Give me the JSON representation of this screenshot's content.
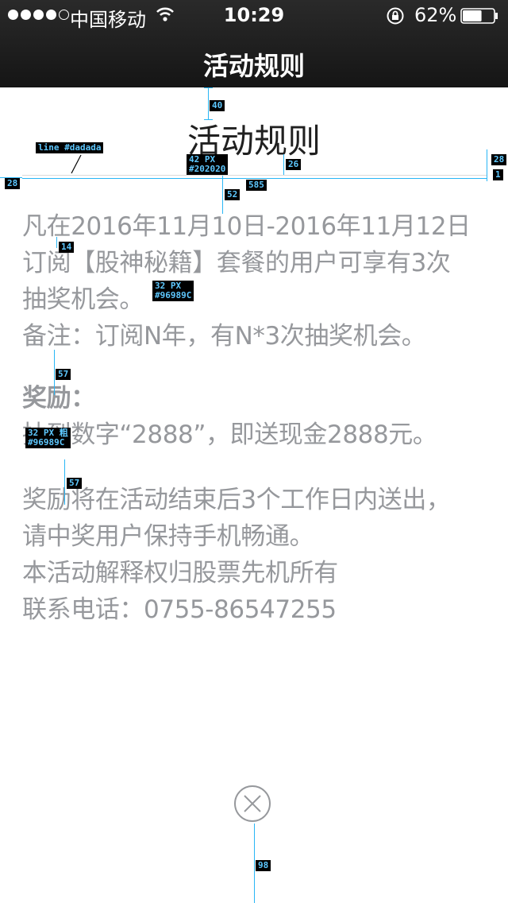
{
  "statusbar": {
    "carrier": "中国移动",
    "time": "10:29",
    "battery": "62%",
    "battery_level": 0.62,
    "signal_strength": 4,
    "signal_max": 5
  },
  "nav": {
    "title": "活动规则"
  },
  "content": {
    "title": "活动规则",
    "lines": [
      "凡在2016年11月10日-2016年11月12日",
      "订阅【股神秘籍】套餐的用户可享有3次",
      "抽奖机会。",
      "备注：订阅N年，有N*3次抽奖机会。"
    ],
    "reward_heading": "奖励：",
    "reward_line": "抽到数字“2888”，即送现金2888元。",
    "notes": [
      "奖励将在活动结束后3个工作日内送出，",
      "请中奖用户保持手机畅通。",
      "本活动解释权归股票先机所有",
      "联系电话：0755-86547255"
    ]
  },
  "annotations": {
    "nav_gap": "40",
    "line_note": "line #dadada",
    "title_size": "42 PX",
    "title_color": "#202020",
    "title_gap": "26",
    "right_margin": "28",
    "line_thickness": "1",
    "left_margin": "28",
    "line_width": "585",
    "body_gap": "52",
    "line_spacing": "14",
    "body_size": "32 PX",
    "body_color": "#96989C",
    "para_gap_1": "57",
    "bold_size": "32 PX 粗",
    "bold_color": "#96989C",
    "para_gap_2": "57",
    "bottom_gap": "98"
  },
  "colors": {
    "nav_bg": "#1c1c1c",
    "title": "#202020",
    "body": "#96989c",
    "rule": "#dadada",
    "annotation": "#29b6f6"
  },
  "icons": [
    "signal-dots-icon",
    "wifi-icon",
    "orientation-lock-icon",
    "battery-icon",
    "close-circle-icon"
  ]
}
